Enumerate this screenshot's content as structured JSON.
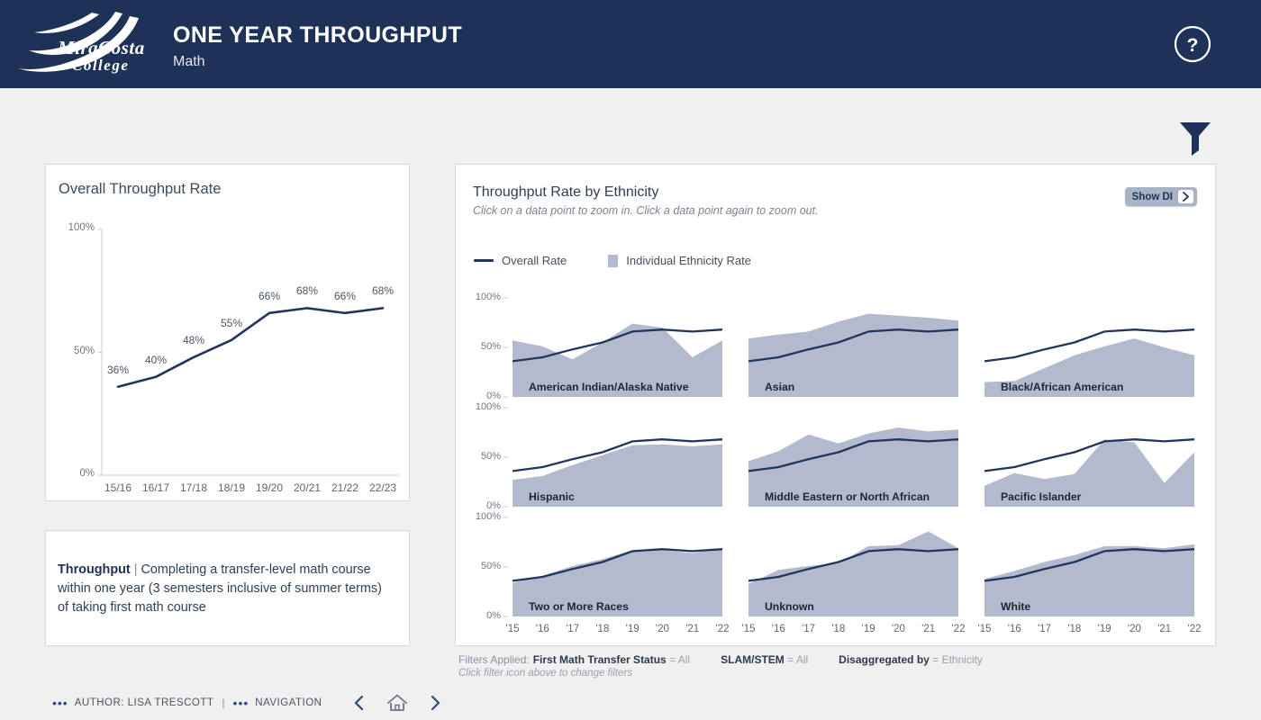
{
  "header": {
    "logo_line1": "MiraCosta",
    "logo_line2": "College",
    "title": "ONE YEAR THROUGHPUT",
    "subtitle": "Math",
    "help_icon": "help-circle-icon"
  },
  "toolbar": {
    "filter_icon": "funnel-icon"
  },
  "overall_panel": {
    "title": "Overall Throughput Rate"
  },
  "definition_panel": {
    "term": "Throughput",
    "separator": "|",
    "text": " Completing a transfer-level math course within one year (3 semesters inclusive of summer terms) of taking first math course"
  },
  "ethnicity_panel": {
    "title": "Throughput Rate by Ethnicity",
    "hint": "Click on a data point to zoom in. Click a data point again to zoom out.",
    "show_di_label": "Show DI",
    "show_di_arrow_icon": "chevron-right-icon",
    "legend": [
      {
        "label": "Overall Rate",
        "marker": "line",
        "color": "#21355e"
      },
      {
        "label": "Individual Ethnicity Rate",
        "marker": "swatch",
        "color": "#b3bacd"
      }
    ]
  },
  "filters": {
    "lead": "Filters Applied:",
    "items": [
      {
        "name": "First Math Transfer Status",
        "eq": "=",
        "value": "All"
      },
      {
        "name": "SLAM/STEM",
        "eq": "=",
        "value": "All"
      },
      {
        "name": "Disaggregated by",
        "eq": "=",
        "value": "Ethnicity"
      }
    ],
    "hint": "Click filter icon above to change filters"
  },
  "footer": {
    "author_label": "AUTHOR: LISA TRESCOTT",
    "separator": "|",
    "navigation_label": "NAVIGATION",
    "prev_icon": "chevron-left-icon",
    "home_icon": "home-icon",
    "next_icon": "chevron-right-icon"
  },
  "colors": {
    "header_bg": "#1e3258",
    "page_bg": "#f0f0f0",
    "line": "#21355e",
    "area": "#b3bacd",
    "panel_border": "#d5dae3"
  },
  "chart_data": [
    {
      "type": "line",
      "id": "overall-throughput-rate",
      "title": "Overall Throughput Rate",
      "xlabel": "",
      "ylabel": "",
      "categories": [
        "15/16",
        "16/17",
        "17/18",
        "18/19",
        "19/20",
        "20/21",
        "21/22",
        "22/23"
      ],
      "values": [
        36,
        40,
        48,
        55,
        66,
        68,
        66,
        68
      ],
      "data_labels": [
        "36%",
        "40%",
        "48%",
        "55%",
        "66%",
        "68%",
        "66%",
        "68%"
      ],
      "ylim": [
        0,
        100
      ],
      "yticks": [
        0,
        50,
        100
      ],
      "ytick_labels": [
        "0%",
        "50%",
        "100%"
      ],
      "grid": false,
      "legend_position": "none",
      "line_color": "#21355e"
    },
    {
      "type": "area",
      "id": "throughput-rate-by-ethnicity",
      "title": "Throughput Rate by Ethnicity",
      "subtitle": "Click on a data point to zoom in. Click a data point again to zoom out.",
      "xlabel": "",
      "ylabel": "",
      "x": [
        "'15",
        "'16",
        "'17",
        "'18",
        "'19",
        "'20",
        "'21",
        "'22"
      ],
      "ylim": [
        0,
        100
      ],
      "yticks": [
        0,
        50,
        100
      ],
      "ytick_labels": [
        "0%",
        "50%",
        "100%"
      ],
      "grid": false,
      "legend_position": "top-left",
      "overall_series": {
        "name": "Overall Rate",
        "values": [
          36,
          40,
          48,
          55,
          66,
          68,
          66,
          68
        ],
        "color": "#21355e"
      },
      "panels": [
        {
          "name": "American Indian/Alaska Native",
          "values": [
            57,
            51,
            38,
            55,
            74,
            70,
            40,
            57
          ]
        },
        {
          "name": "Asian",
          "values": [
            59,
            63,
            66,
            76,
            84,
            82,
            80,
            77
          ]
        },
        {
          "name": "Black/African American",
          "values": [
            15,
            16,
            29,
            42,
            51,
            59,
            50,
            42
          ]
        },
        {
          "name": "Hispanic",
          "values": [
            27,
            31,
            42,
            52,
            62,
            63,
            61,
            63
          ]
        },
        {
          "name": "Middle Eastern or North African",
          "values": [
            46,
            56,
            73,
            64,
            74,
            80,
            76,
            78
          ]
        },
        {
          "name": "Pacific Islander",
          "values": [
            21,
            34,
            28,
            33,
            68,
            65,
            24,
            55
          ]
        },
        {
          "name": "Two or More Races",
          "values": [
            34,
            41,
            51,
            58,
            67,
            67,
            64,
            69
          ]
        },
        {
          "name": "Unknown",
          "values": [
            33,
            47,
            51,
            54,
            71,
            72,
            86,
            69
          ]
        },
        {
          "name": "White",
          "values": [
            38,
            46,
            55,
            62,
            71,
            71,
            69,
            73
          ]
        }
      ]
    }
  ]
}
